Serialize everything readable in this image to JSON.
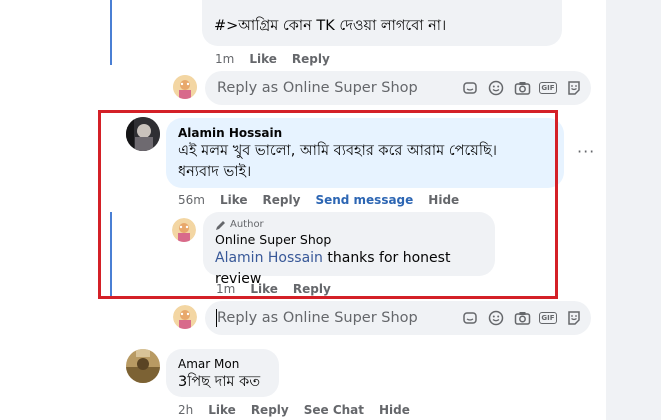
{
  "colors": {
    "accent": "#2d66b3",
    "highlight_border": "#d42027",
    "thread_line": "#4a7fd4"
  },
  "top_comment": {
    "text": "#>আগ্রিম কোন TK দেওয়া লাগবো না।",
    "actions": {
      "time": "1m",
      "like": "Like",
      "reply": "Reply"
    }
  },
  "reply_box_1": {
    "placeholder": "Reply as Online Super Shop"
  },
  "main_comment": {
    "author": "Alamin Hossain",
    "text_line1": "এই মলম খুব ভালো, আমি ব্যবহার করে আরাম পেয়েছি।",
    "text_line2": "ধন্যবাদ ভাই।",
    "more": "···",
    "actions": {
      "time": "56m",
      "like": "Like",
      "reply": "Reply",
      "send_message": "Send message",
      "hide": "Hide"
    }
  },
  "page_reply": {
    "badge": "Author",
    "author": "Online Super Shop",
    "mention": "Alamin Hossain",
    "text": " thanks for honest review",
    "actions": {
      "time": "1m",
      "like": "Like",
      "reply": "Reply"
    }
  },
  "reply_box_2": {
    "placeholder": "Reply as Online Super Shop"
  },
  "third_comment": {
    "author": "Amar Mon",
    "text": "3পিছ দাম কত",
    "actions": {
      "time": "2h",
      "like": "Like",
      "reply": "Reply",
      "see_chat": "See Chat",
      "hide": "Hide"
    }
  },
  "icons": [
    "sticker-icon",
    "emoji-icon",
    "camera-icon",
    "gif-icon",
    "avatar-sticker-icon",
    "pencil-icon",
    "more-icon"
  ]
}
